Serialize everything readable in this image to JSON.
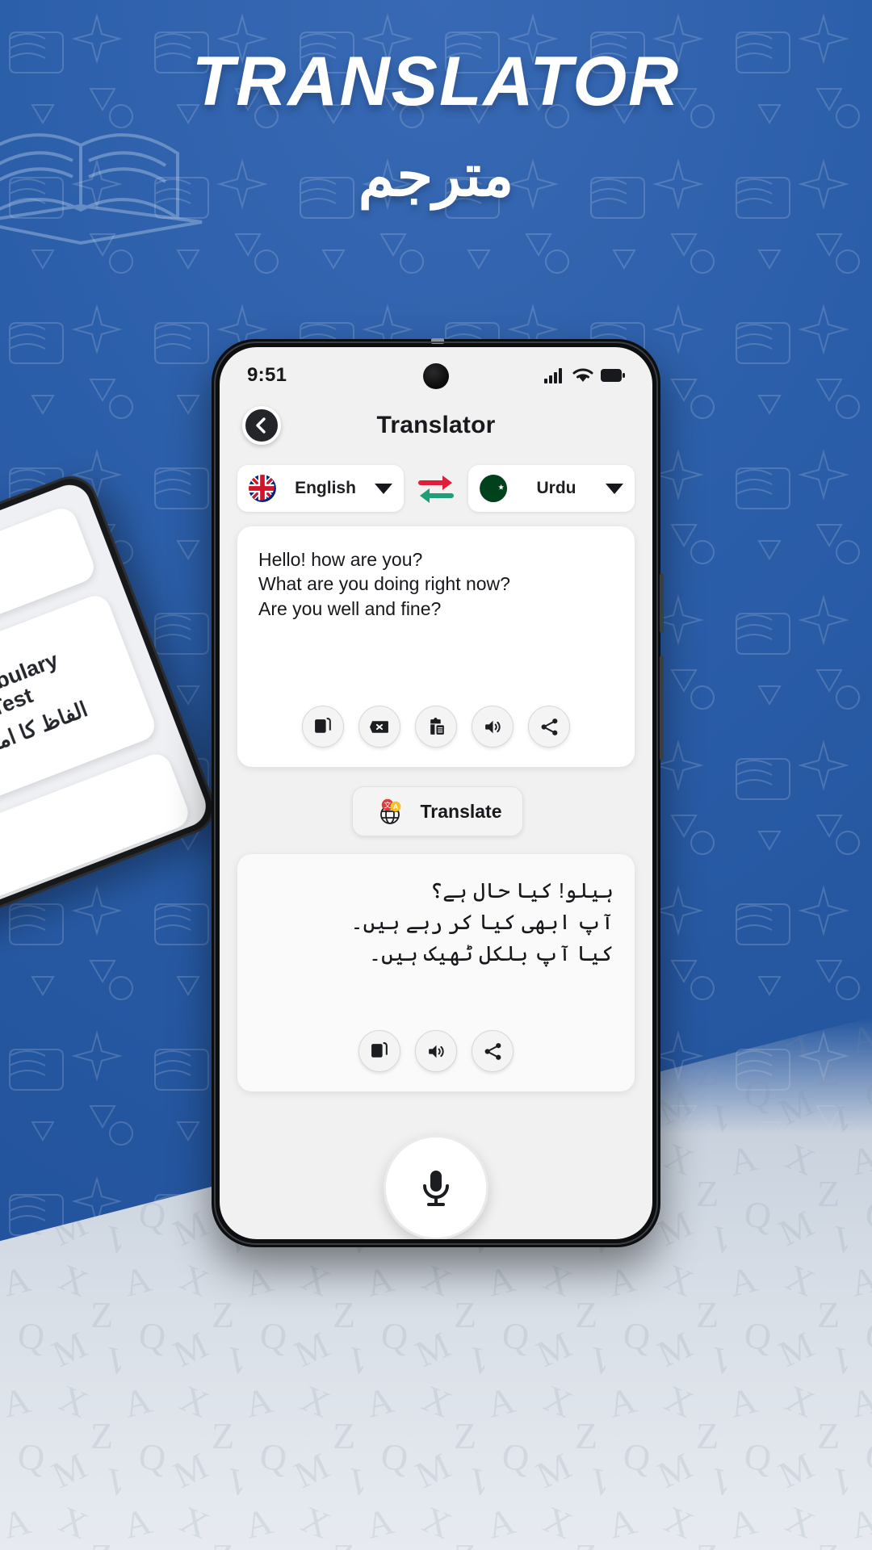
{
  "promo": {
    "headline": "TRANSLATOR",
    "subhead_urdu": "مترجم",
    "bg_color": "#2b5ea9",
    "bg_bottom_color": "#d9dfe7"
  },
  "tablet_preview": {
    "badge_icon": "camera-translate-icon",
    "title_en_line1": "Vocabulary",
    "title_en_line2": "Test",
    "title_urdu": "الفاظ کا امتحان"
  },
  "phone": {
    "status_bar": {
      "time": "9:51",
      "icons": [
        "signal-icon",
        "wifi-icon",
        "battery-icon"
      ]
    },
    "app_bar": {
      "back_icon": "back-chevron-icon",
      "title": "Translator"
    },
    "language_row": {
      "source": {
        "flag": "uk-flag-icon",
        "name": "English",
        "caret": "chevron-down-icon"
      },
      "swap_icon": "swap-arrows-icon",
      "swap_colors": {
        "top_arrow": "#e01e3c",
        "bottom_arrow": "#1f9e77"
      },
      "target": {
        "flag": "pakistan-flag-icon",
        "name": "Urdu",
        "caret": "chevron-down-icon"
      }
    },
    "input_card": {
      "lines": [
        "Hello! how are you?",
        "What are you doing right now?",
        "Are you well and fine?"
      ],
      "actions": [
        {
          "name": "copy-icon",
          "label": "Copy"
        },
        {
          "name": "clear-icon",
          "label": "Clear"
        },
        {
          "name": "paste-icon",
          "label": "Paste"
        },
        {
          "name": "speaker-icon",
          "label": "Speak"
        },
        {
          "name": "share-icon",
          "label": "Share"
        }
      ]
    },
    "translate_button": {
      "icon": "globe-translate-icon",
      "label": "Translate",
      "badge_red": "#e53935",
      "badge_yellow": "#f9c025"
    },
    "output_card": {
      "lines": [
        "ہیلو! کیا حال ہے؟",
        "آپ ابھی کیا کر رہے ہیں۔",
        "کیا آپ بلکل ٹھیک ہیں۔"
      ],
      "actions": [
        {
          "name": "copy-icon",
          "label": "Copy"
        },
        {
          "name": "speaker-icon",
          "label": "Speak"
        },
        {
          "name": "share-icon",
          "label": "Share"
        }
      ]
    },
    "mic_button": {
      "icon": "microphone-icon",
      "label": "Voice input"
    }
  }
}
